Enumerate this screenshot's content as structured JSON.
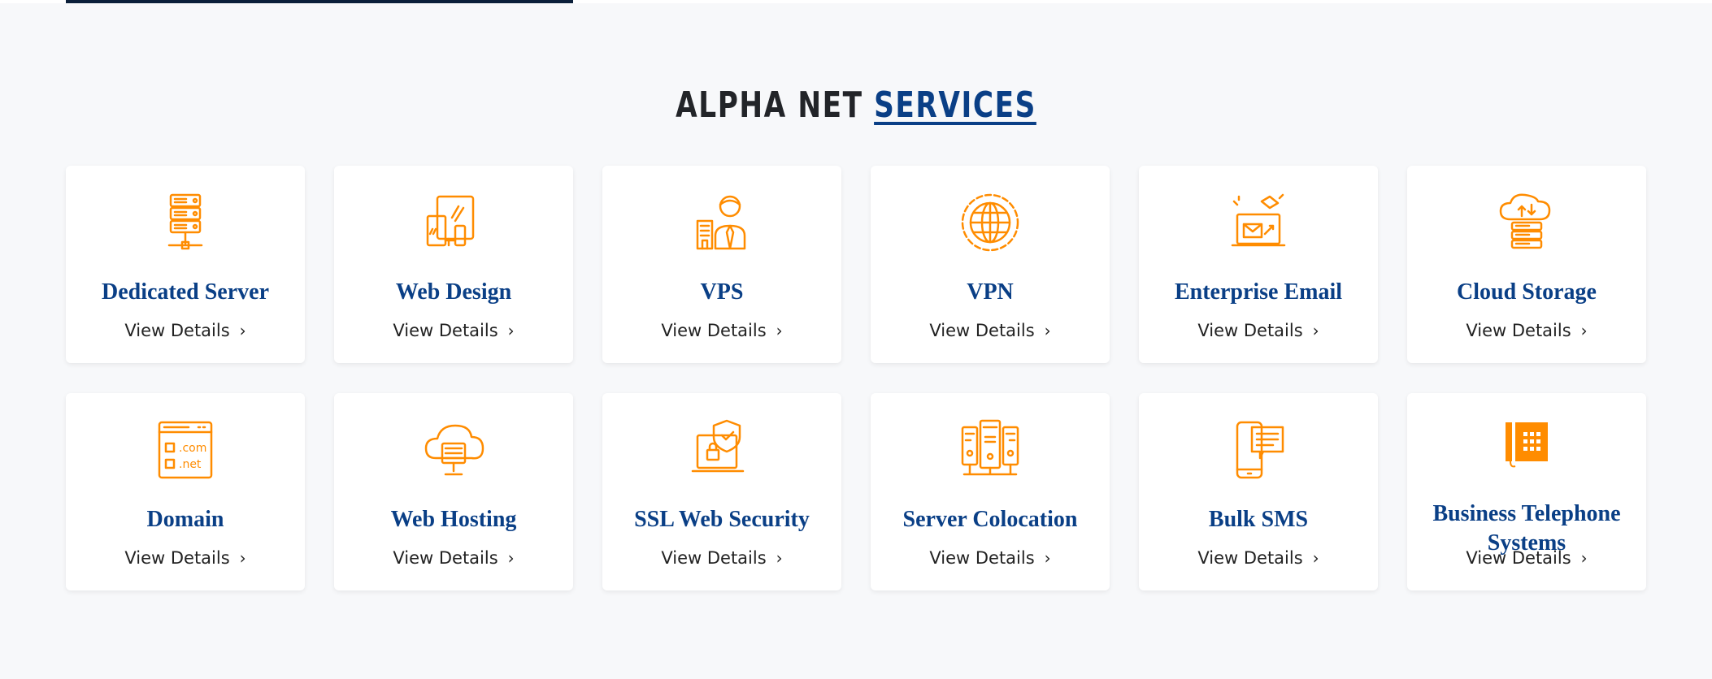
{
  "heading": {
    "prefix": "ALPHA NET",
    "highlight": "SERVICES"
  },
  "colors": {
    "accent": "#ff8c00",
    "title": "#0a3f86",
    "heading": "#222428",
    "background": "#f7f8fa",
    "top_bar": "#0b1f3a"
  },
  "link_label": "View Details",
  "chevron": "›",
  "services": [
    {
      "title": "Dedicated Server",
      "icon": "server-rack-icon"
    },
    {
      "title": "Web Design",
      "icon": "devices-icon"
    },
    {
      "title": "VPS",
      "icon": "businessman-building-icon"
    },
    {
      "title": "VPN",
      "icon": "globe-icon"
    },
    {
      "title": "Enterprise Email",
      "icon": "email-laptop-icon"
    },
    {
      "title": "Cloud Storage",
      "icon": "cloud-server-icon"
    },
    {
      "title": "Domain",
      "icon": "domain-browser-icon"
    },
    {
      "title": "Web Hosting",
      "icon": "cloud-hosting-icon"
    },
    {
      "title": "SSL Web Security",
      "icon": "shield-laptop-icon"
    },
    {
      "title": "Server Colocation",
      "icon": "server-colocation-icon"
    },
    {
      "title": "Bulk SMS",
      "icon": "phone-message-icon"
    },
    {
      "title": "Business Telephone Systems",
      "icon": "desk-phone-icon"
    }
  ]
}
